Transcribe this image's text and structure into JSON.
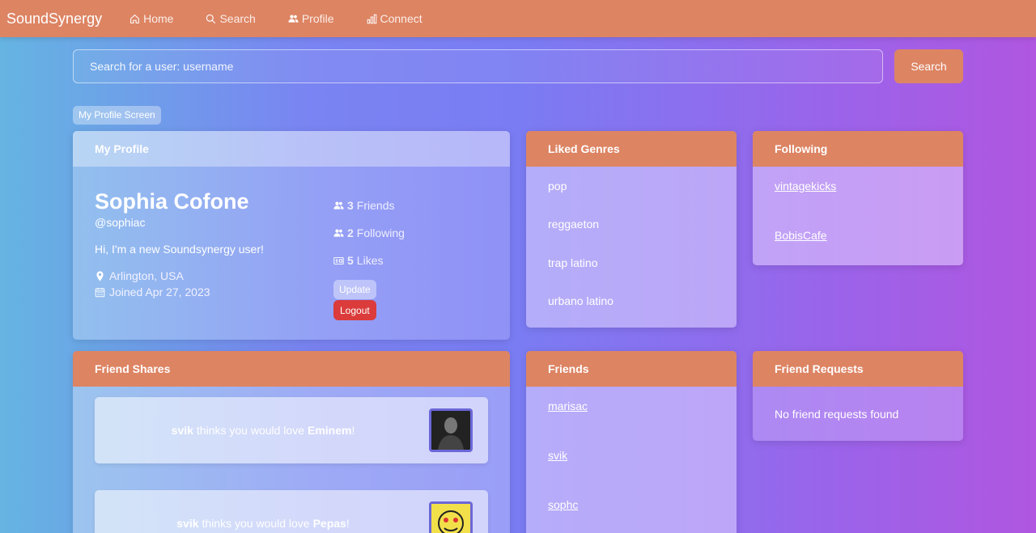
{
  "nav": {
    "brand": "SoundSynergy",
    "items": [
      {
        "label": "Home",
        "icon": "home-icon"
      },
      {
        "label": "Search",
        "icon": "search-icon"
      },
      {
        "label": "Profile",
        "icon": "users-icon"
      },
      {
        "label": "Connect",
        "icon": "bar-chart-icon"
      }
    ]
  },
  "search": {
    "placeholder": "Search for a user: username",
    "button_label": "Search"
  },
  "screen_badge": "My Profile Screen",
  "profile": {
    "header": "My Profile",
    "name": "Sophia Cofone",
    "handle": "@sophiac",
    "bio": "Hi, I'm a new Soundsynergy user!",
    "location": "Arlington, USA",
    "joined": "Joined Apr 27, 2023",
    "stats": {
      "friends_count": "3",
      "friends_label": "Friends",
      "following_count": "2",
      "following_label": "Following",
      "likes_count": "5",
      "likes_label": "Likes"
    },
    "update_label": "Update",
    "logout_label": "Logout"
  },
  "genres": {
    "header": "Liked Genres",
    "items": [
      "pop",
      "reggaeton",
      "trap latino",
      "urbano latino"
    ]
  },
  "following": {
    "header": "Following",
    "items": [
      "vintagekicks",
      "BobisCafe"
    ]
  },
  "friend_shares": {
    "header": "Friend Shares",
    "items": [
      {
        "user": "svik",
        "middle": "thinks you would love",
        "artist": "Eminem",
        "end": "!"
      },
      {
        "user": "svik",
        "middle": "thinks you would love",
        "artist": "Pepas",
        "end": "!"
      }
    ]
  },
  "friends": {
    "header": "Friends",
    "items": [
      "marisac",
      "svik",
      "sophc"
    ]
  },
  "friend_requests": {
    "header": "Friend Requests",
    "empty_message": "No friend requests found"
  },
  "colors": {
    "accent": "#dd8463",
    "logout": "#db3b3b",
    "thumb_border": "#6b67d8"
  }
}
